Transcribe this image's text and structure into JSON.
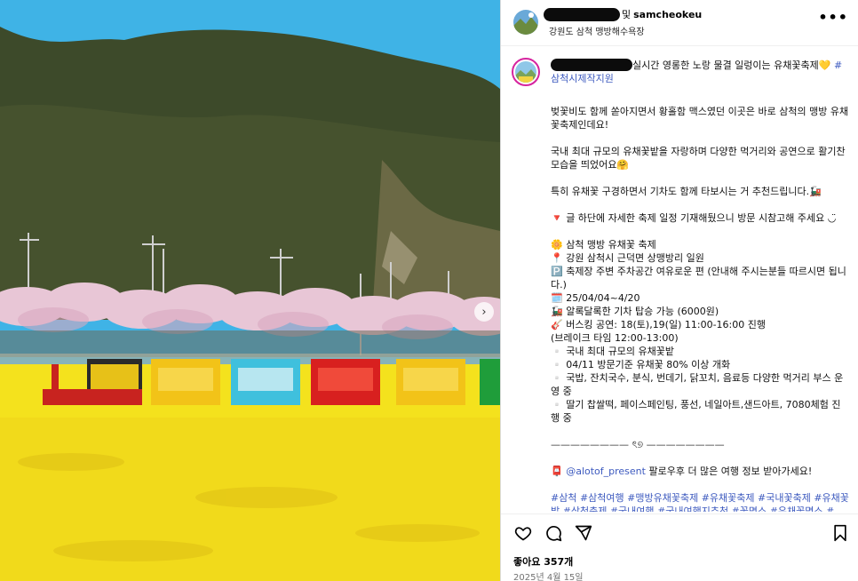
{
  "header": {
    "and_text": "및",
    "collab_username": "samcheokeu",
    "location": "강원도 삼척 맹방해수욕장",
    "more_icon": "more-horizontal-icon"
  },
  "photo": {
    "next_icon": "chevron-right-icon",
    "next_glyph": "›",
    "colors": {
      "sky": "#3fb3e6",
      "mountain": "#3d4a2a",
      "blossom": "#e8c6d6",
      "rapeseed": "#f4e21d"
    }
  },
  "caption": {
    "first_line": "실시간 영롱한 노랑 물결 일렁이는 유채꽃축제💛 ",
    "first_line_tag": "#삼척시제작지원",
    "para1": "벚꽃비도 함께 쏟아지면서 황홀함 맥스였던 이곳은 바로 삼척의 맹방 유채꽃축제인데요!",
    "para2": "국내 최대 규모의 유채꽃밭을 자랑하며 다양한 먹거리와 공연으로 활기찬 모습을 띄었어요🤗",
    "para3": "특히 유채꽃 구경하면서 기차도 함께 타보시는 거 추천드립니다.🚂",
    "para4": "🔻 글 하단에 자세한 축제 일정 기재해뒀으니 방문 시참고해 주세요 ◡̈",
    "details": [
      "🌼 삼척 맹방 유채꽃 축제",
      "📍 강원 삼척시 근덕면 상맹방리 일원",
      "🅿️ 축제장 주변 주차공간 여유로운 편 (안내해 주시는분들 따르시면 됩니다.)",
      "🗓️ 25/04/04~4/20",
      "🚂 알록달록한 기차 탑승 가능 (6000원)",
      "🎸 버스킹 공연: 18(토),19(일) 11:00-16:00 진행",
      "(브레이크 타임 12:00-13:00)",
      "▫️ 국내 최대 규모의 유채꽃밭",
      "▫️ 04/11 방문기준 유채꽃 80% 이상 개화",
      "▫️ 국밥, 잔치국수, 분식, 번데기, 닭꼬치, 음료등 다양한 먹거리 부스 운영 중",
      "▫️ 딸기 찹쌀떡, 페이스페인팅, 풍선, 네일아트,샌드아트, 7080체험 진행 중"
    ],
    "divider": "———————— ৎ୭ ————————",
    "follow_icon": "📮 ",
    "follow_handle": "@alotof_present",
    "follow_text": " 팔로우후 더 많은 여행 정보 받아가세요!",
    "hashtags": "#삼척 #삼척여행 #맹방유채꽃축제 #유채꽃축제 #국내꽃축제 #유채꽃밭 #삼척축제 #국내여행 #국내여행지추천 #꽃명소 #유채꽃명소 #"
  },
  "actions": {
    "like_icon": "heart-icon",
    "comment_icon": "comment-icon",
    "share_icon": "share-icon",
    "save_icon": "bookmark-icon",
    "likes": "좋아요 357개",
    "date": "2025년 4월 15일"
  }
}
